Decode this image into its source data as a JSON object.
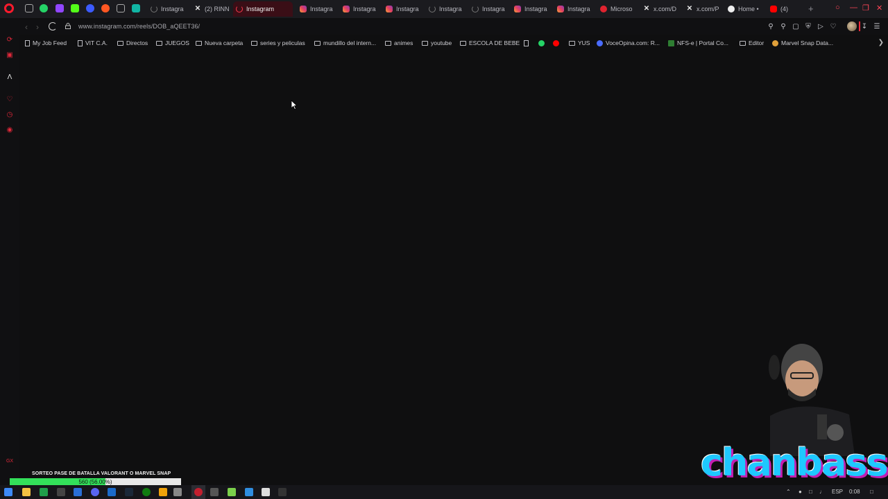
{
  "tabs": [
    {
      "label": "Instagra",
      "icon": "loading-spinner-icon",
      "active": false
    },
    {
      "label": "(2) RINN",
      "icon": "x-logo-icon",
      "active": false
    },
    {
      "label": "Instagram",
      "icon": "loading-spinner-icon",
      "active": true
    },
    {
      "label": "Instagra",
      "icon": "instagram-icon",
      "active": false
    },
    {
      "label": "Instagra",
      "icon": "instagram-icon",
      "active": false
    },
    {
      "label": "Instagra",
      "icon": "instagram-icon",
      "active": false
    },
    {
      "label": "Instagra",
      "icon": "loading-spinner-icon",
      "active": false
    },
    {
      "label": "Instagra",
      "icon": "loading-spinner-icon",
      "active": false
    },
    {
      "label": "Instagra",
      "icon": "instagram-icon",
      "active": false
    },
    {
      "label": "Instagra",
      "icon": "instagram-icon",
      "active": false
    },
    {
      "label": "Microso",
      "icon": "microsoft-icon",
      "active": false
    },
    {
      "label": "x.com/D",
      "icon": "x-logo-icon",
      "active": false
    },
    {
      "label": "x.com/P",
      "icon": "x-logo-icon",
      "active": false
    },
    {
      "label": "Home •",
      "icon": "github-icon",
      "active": false
    },
    {
      "label": "(4)",
      "icon": "youtube-icon",
      "active": false
    }
  ],
  "address": {
    "url": "www.instagram.com/reels/DOB_aQEET36/"
  },
  "bookmarks": [
    {
      "label": "My Job Feed",
      "icon": "page-icon"
    },
    {
      "label": "VIT C.A.",
      "icon": "page-icon"
    },
    {
      "label": "Directos",
      "icon": "folder-icon"
    },
    {
      "label": "JUEGOS",
      "icon": "folder-icon"
    },
    {
      "label": "Nueva carpeta",
      "icon": "folder-icon"
    },
    {
      "label": "series y peliculas",
      "icon": "folder-icon"
    },
    {
      "label": "mundillo del intern...",
      "icon": "folder-icon"
    },
    {
      "label": "animes",
      "icon": "folder-icon"
    },
    {
      "label": "youtube",
      "icon": "folder-icon"
    },
    {
      "label": "ESCOLA DE BEBE",
      "icon": "folder-icon"
    },
    {
      "label": "",
      "icon": "page-icon"
    },
    {
      "label": "",
      "icon": "whatsapp-icon"
    },
    {
      "label": "",
      "icon": "youtube-icon"
    },
    {
      "label": "YUS",
      "icon": "folder-icon"
    },
    {
      "label": "VoceOpina.com: R...",
      "icon": "verified-icon"
    },
    {
      "label": "NFS-e | Portal Co...",
      "icon": "nfse-icon"
    },
    {
      "label": "Editor",
      "icon": "folder-icon"
    },
    {
      "label": "Marvel Snap Data...",
      "icon": "snap-icon"
    }
  ],
  "overlay": {
    "raffle_title": "SORTEO PASE DE BATALLA VALORANT O MARVEL SNAP",
    "progress_text": "560 (56.00%)",
    "progress_fraction": 0.56,
    "brand": "chanbass"
  },
  "taskbar": {
    "tray_lang": "ESP",
    "time": "0:08"
  },
  "colors": {
    "accent": "#ff1b2d",
    "progress_fill": "#33e05a",
    "active_tab": "#3a0e16"
  }
}
